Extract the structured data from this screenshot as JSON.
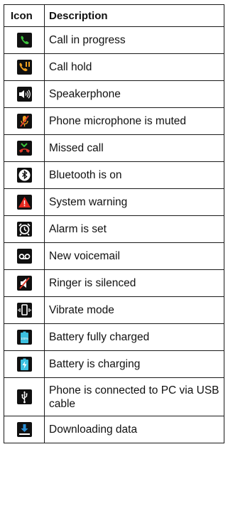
{
  "table": {
    "headers": {
      "icon": "Icon",
      "description": "Description"
    },
    "rows": [
      {
        "icon": "phone-call-icon",
        "description": "Call in progress"
      },
      {
        "icon": "call-hold-icon",
        "description": "Call hold"
      },
      {
        "icon": "speakerphone-icon",
        "description": "Speakerphone"
      },
      {
        "icon": "microphone-muted-icon",
        "description": "Phone microphone is muted"
      },
      {
        "icon": "missed-call-icon",
        "description": "Missed call"
      },
      {
        "icon": "bluetooth-icon",
        "description": "Bluetooth is on"
      },
      {
        "icon": "warning-icon",
        "description": "System warning"
      },
      {
        "icon": "alarm-icon",
        "description": "Alarm is set"
      },
      {
        "icon": "voicemail-icon",
        "description": "New voicemail"
      },
      {
        "icon": "ringer-silenced-icon",
        "description": "Ringer is silenced"
      },
      {
        "icon": "vibrate-icon",
        "description": "Vibrate mode"
      },
      {
        "icon": "battery-full-icon",
        "description": "Battery fully charged",
        "icon_text": "100%"
      },
      {
        "icon": "battery-charging-icon",
        "description": "Battery is charging"
      },
      {
        "icon": "usb-icon",
        "description": "Phone is connected to PC via USB cable"
      },
      {
        "icon": "download-icon",
        "description": "Downloading data"
      }
    ]
  },
  "colors": {
    "icon_bg": "#101010",
    "call_green": "#3cc43c",
    "hold_orange": "#f0a020",
    "missed_red": "#e03a2a",
    "warning_red": "#e8281e",
    "battery_teal": "#3cc0e0",
    "download_blue": "#2a8fd6"
  }
}
